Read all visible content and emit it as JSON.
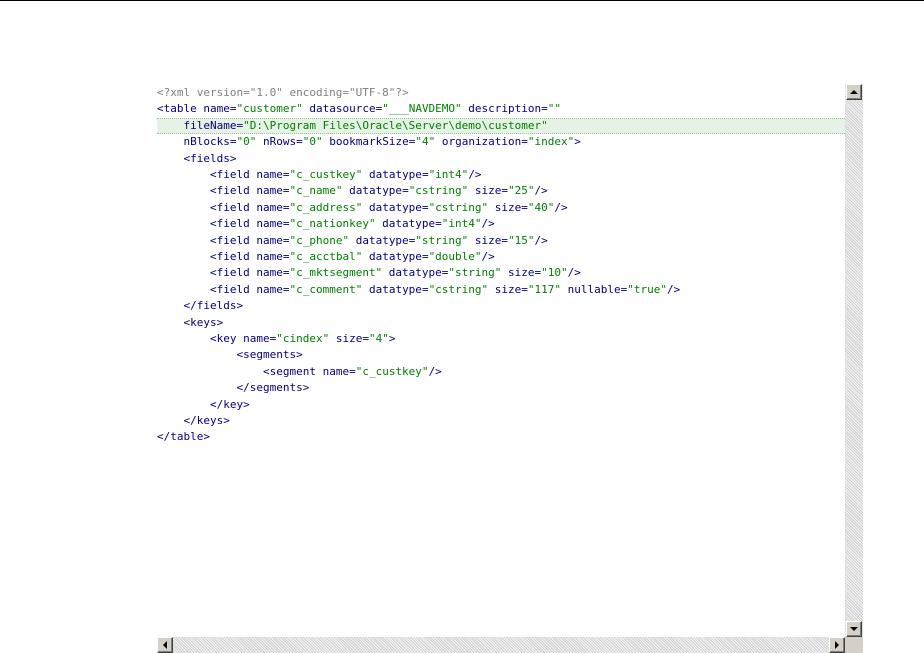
{
  "editor": {
    "highlighted_line": 2,
    "lines": [
      [
        {
          "c": "pi",
          "t": "<?xml version=\"1.0\" encoding=\"UTF-8\"?>"
        }
      ],
      [
        {
          "c": "tag",
          "t": "<table "
        },
        {
          "c": "attr",
          "t": "name"
        },
        {
          "c": "eq",
          "t": "="
        },
        {
          "c": "val",
          "t": "\"customer\""
        },
        {
          "c": "attr",
          "t": " datasource"
        },
        {
          "c": "eq",
          "t": "="
        },
        {
          "c": "val",
          "t": "\"___NAVDEMO\""
        },
        {
          "c": "attr",
          "t": " description"
        },
        {
          "c": "eq",
          "t": "="
        },
        {
          "c": "val",
          "t": "\"\""
        }
      ],
      [
        {
          "c": "attr",
          "t": "    fileName"
        },
        {
          "c": "eq",
          "t": "="
        },
        {
          "c": "val",
          "t": "\"D:\\Program Files\\Oracle\\Server\\demo\\customer\""
        }
      ],
      [
        {
          "c": "attr",
          "t": "    nBlocks"
        },
        {
          "c": "eq",
          "t": "="
        },
        {
          "c": "val",
          "t": "\"0\""
        },
        {
          "c": "attr",
          "t": " nRows"
        },
        {
          "c": "eq",
          "t": "="
        },
        {
          "c": "val",
          "t": "\"0\""
        },
        {
          "c": "attr",
          "t": " bookmarkSize"
        },
        {
          "c": "eq",
          "t": "="
        },
        {
          "c": "val",
          "t": "\"4\""
        },
        {
          "c": "attr",
          "t": " organization"
        },
        {
          "c": "eq",
          "t": "="
        },
        {
          "c": "val",
          "t": "\"index\""
        },
        {
          "c": "tag",
          "t": ">"
        }
      ],
      [
        {
          "c": "tag",
          "t": "    <fields>"
        }
      ],
      [
        {
          "c": "tag",
          "t": "        <field "
        },
        {
          "c": "attr",
          "t": "name"
        },
        {
          "c": "eq",
          "t": "="
        },
        {
          "c": "val",
          "t": "\"c_custkey\""
        },
        {
          "c": "attr",
          "t": " datatype"
        },
        {
          "c": "eq",
          "t": "="
        },
        {
          "c": "val",
          "t": "\"int4\""
        },
        {
          "c": "tag",
          "t": "/>"
        }
      ],
      [
        {
          "c": "tag",
          "t": "        <field "
        },
        {
          "c": "attr",
          "t": "name"
        },
        {
          "c": "eq",
          "t": "="
        },
        {
          "c": "val",
          "t": "\"c_name\""
        },
        {
          "c": "attr",
          "t": " datatype"
        },
        {
          "c": "eq",
          "t": "="
        },
        {
          "c": "val",
          "t": "\"cstring\""
        },
        {
          "c": "attr",
          "t": " size"
        },
        {
          "c": "eq",
          "t": "="
        },
        {
          "c": "val",
          "t": "\"25\""
        },
        {
          "c": "tag",
          "t": "/>"
        }
      ],
      [
        {
          "c": "tag",
          "t": "        <field "
        },
        {
          "c": "attr",
          "t": "name"
        },
        {
          "c": "eq",
          "t": "="
        },
        {
          "c": "val",
          "t": "\"c_address\""
        },
        {
          "c": "attr",
          "t": " datatype"
        },
        {
          "c": "eq",
          "t": "="
        },
        {
          "c": "val",
          "t": "\"cstring\""
        },
        {
          "c": "attr",
          "t": " size"
        },
        {
          "c": "eq",
          "t": "="
        },
        {
          "c": "val",
          "t": "\"40\""
        },
        {
          "c": "tag",
          "t": "/>"
        }
      ],
      [
        {
          "c": "tag",
          "t": "        <field "
        },
        {
          "c": "attr",
          "t": "name"
        },
        {
          "c": "eq",
          "t": "="
        },
        {
          "c": "val",
          "t": "\"c_nationkey\""
        },
        {
          "c": "attr",
          "t": " datatype"
        },
        {
          "c": "eq",
          "t": "="
        },
        {
          "c": "val",
          "t": "\"int4\""
        },
        {
          "c": "tag",
          "t": "/>"
        }
      ],
      [
        {
          "c": "tag",
          "t": "        <field "
        },
        {
          "c": "attr",
          "t": "name"
        },
        {
          "c": "eq",
          "t": "="
        },
        {
          "c": "val",
          "t": "\"c_phone\""
        },
        {
          "c": "attr",
          "t": " datatype"
        },
        {
          "c": "eq",
          "t": "="
        },
        {
          "c": "val",
          "t": "\"string\""
        },
        {
          "c": "attr",
          "t": " size"
        },
        {
          "c": "eq",
          "t": "="
        },
        {
          "c": "val",
          "t": "\"15\""
        },
        {
          "c": "tag",
          "t": "/>"
        }
      ],
      [
        {
          "c": "tag",
          "t": "        <field "
        },
        {
          "c": "attr",
          "t": "name"
        },
        {
          "c": "eq",
          "t": "="
        },
        {
          "c": "val",
          "t": "\"c_acctbal\""
        },
        {
          "c": "attr",
          "t": " datatype"
        },
        {
          "c": "eq",
          "t": "="
        },
        {
          "c": "val",
          "t": "\"double\""
        },
        {
          "c": "tag",
          "t": "/>"
        }
      ],
      [
        {
          "c": "tag",
          "t": "        <field "
        },
        {
          "c": "attr",
          "t": "name"
        },
        {
          "c": "eq",
          "t": "="
        },
        {
          "c": "val",
          "t": "\"c_mktsegment\""
        },
        {
          "c": "attr",
          "t": " datatype"
        },
        {
          "c": "eq",
          "t": "="
        },
        {
          "c": "val",
          "t": "\"string\""
        },
        {
          "c": "attr",
          "t": " size"
        },
        {
          "c": "eq",
          "t": "="
        },
        {
          "c": "val",
          "t": "\"10\""
        },
        {
          "c": "tag",
          "t": "/>"
        }
      ],
      [
        {
          "c": "tag",
          "t": "        <field "
        },
        {
          "c": "attr",
          "t": "name"
        },
        {
          "c": "eq",
          "t": "="
        },
        {
          "c": "val",
          "t": "\"c_comment\""
        },
        {
          "c": "attr",
          "t": " datatype"
        },
        {
          "c": "eq",
          "t": "="
        },
        {
          "c": "val",
          "t": "\"cstring\""
        },
        {
          "c": "attr",
          "t": " size"
        },
        {
          "c": "eq",
          "t": "="
        },
        {
          "c": "val",
          "t": "\"117\""
        },
        {
          "c": "attr",
          "t": " nullable"
        },
        {
          "c": "eq",
          "t": "="
        },
        {
          "c": "val",
          "t": "\"true\""
        },
        {
          "c": "tag",
          "t": "/>"
        }
      ],
      [
        {
          "c": "tag",
          "t": "    </fields>"
        }
      ],
      [
        {
          "c": "tag",
          "t": "    <keys>"
        }
      ],
      [
        {
          "c": "tag",
          "t": "        <key "
        },
        {
          "c": "attr",
          "t": "name"
        },
        {
          "c": "eq",
          "t": "="
        },
        {
          "c": "val",
          "t": "\"cindex\""
        },
        {
          "c": "attr",
          "t": " size"
        },
        {
          "c": "eq",
          "t": "="
        },
        {
          "c": "val",
          "t": "\"4\""
        },
        {
          "c": "tag",
          "t": ">"
        }
      ],
      [
        {
          "c": "tag",
          "t": "            <segments>"
        }
      ],
      [
        {
          "c": "tag",
          "t": "                <segment "
        },
        {
          "c": "attr",
          "t": "name"
        },
        {
          "c": "eq",
          "t": "="
        },
        {
          "c": "val",
          "t": "\"c_custkey\""
        },
        {
          "c": "tag",
          "t": "/>"
        }
      ],
      [
        {
          "c": "tag",
          "t": "            </segments>"
        }
      ],
      [
        {
          "c": "tag",
          "t": "        </key>"
        }
      ],
      [
        {
          "c": "tag",
          "t": "    </keys>"
        }
      ],
      [
        {
          "c": "tag",
          "t": "</table>"
        }
      ]
    ]
  },
  "scrollbars": {
    "vertical_up_icon": "arrow-up-icon",
    "vertical_down_icon": "arrow-down-icon",
    "horizontal_left_icon": "arrow-left-icon",
    "horizontal_right_icon": "arrow-right-icon"
  }
}
